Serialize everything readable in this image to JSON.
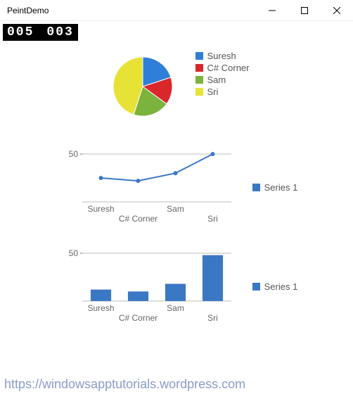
{
  "window": {
    "title": "PeintDemo"
  },
  "counters": {
    "left": "005",
    "right": "003"
  },
  "colors": {
    "suresh": "#2f7ed8",
    "csharp": "#d9272c",
    "sam": "#7bb33d",
    "sri": "#e7e236",
    "series1": "#3b78c4",
    "grid": "#bdbdbd"
  },
  "pie": {
    "legend": [
      {
        "label": "Suresh",
        "color_key": "suresh"
      },
      {
        "label": "C# Corner",
        "color_key": "csharp"
      },
      {
        "label": "Sam",
        "color_key": "sam"
      },
      {
        "label": "Sri",
        "color_key": "sri"
      }
    ]
  },
  "line": {
    "legend_label": "Series 1",
    "y_tick": "50",
    "categories": [
      "Suresh",
      "C# Corner",
      "Sam",
      "Sri"
    ]
  },
  "bar": {
    "legend_label": "Series 1",
    "y_tick": "50",
    "categories": [
      "Suresh",
      "C# Corner",
      "Sam",
      "Sri"
    ]
  },
  "watermark": "https://windowsapptutorials.wordpress.com",
  "chart_data": [
    {
      "type": "pie",
      "title": "",
      "series": [
        {
          "name": "",
          "slices": [
            {
              "label": "Suresh",
              "value": 20,
              "color": "#2f7ed8"
            },
            {
              "label": "C# Corner",
              "value": 15,
              "color": "#d9272c"
            },
            {
              "label": "Sam",
              "value": 20,
              "color": "#7bb33d"
            },
            {
              "label": "Sri",
              "value": 45,
              "color": "#e7e236"
            }
          ]
        }
      ]
    },
    {
      "type": "line",
      "title": "",
      "xlabel": "",
      "ylabel": "",
      "categories": [
        "Suresh",
        "C# Corner",
        "Sam",
        "Sri"
      ],
      "series": [
        {
          "name": "Series 1",
          "values": [
            25,
            22,
            30,
            50
          ],
          "color": "#3b78c4"
        }
      ],
      "ylim": [
        0,
        50
      ]
    },
    {
      "type": "bar",
      "title": "",
      "xlabel": "",
      "ylabel": "",
      "categories": [
        "Suresh",
        "C# Corner",
        "Sam",
        "Sri"
      ],
      "series": [
        {
          "name": "Series 1",
          "values": [
            12,
            10,
            18,
            48
          ],
          "color": "#3b78c4"
        }
      ],
      "ylim": [
        0,
        50
      ]
    }
  ]
}
